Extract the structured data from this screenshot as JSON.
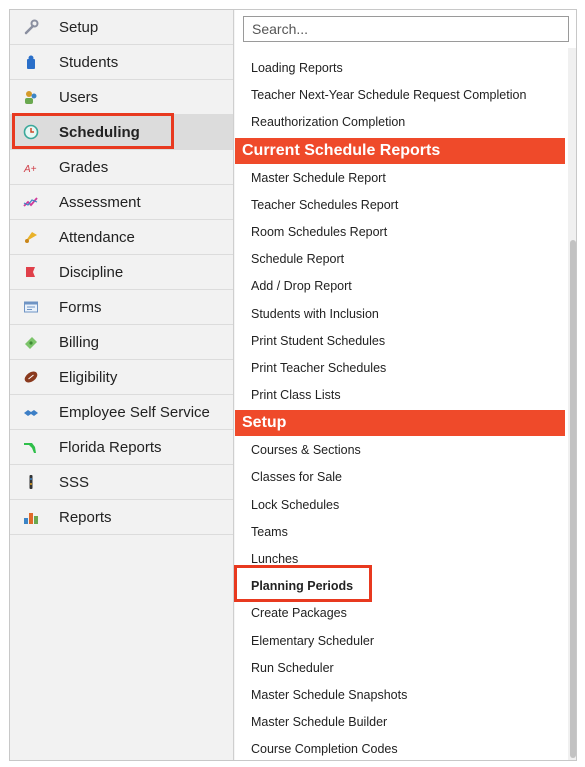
{
  "nav": {
    "items": [
      {
        "label": "Setup",
        "icon": "wrench-icon"
      },
      {
        "label": "Students",
        "icon": "student-icon"
      },
      {
        "label": "Users",
        "icon": "users-icon"
      },
      {
        "label": "Scheduling",
        "icon": "clock-icon"
      },
      {
        "label": "Grades",
        "icon": "grades-icon"
      },
      {
        "label": "Assessment",
        "icon": "assessment-icon"
      },
      {
        "label": "Attendance",
        "icon": "attendance-icon"
      },
      {
        "label": "Discipline",
        "icon": "discipline-icon"
      },
      {
        "label": "Forms",
        "icon": "forms-icon"
      },
      {
        "label": "Billing",
        "icon": "billing-icon"
      },
      {
        "label": "Eligibility",
        "icon": "football-icon"
      },
      {
        "label": "Employee Self Service",
        "icon": "handshake-icon"
      },
      {
        "label": "Florida Reports",
        "icon": "florida-icon"
      },
      {
        "label": "SSS",
        "icon": "sss-icon"
      },
      {
        "label": "Reports",
        "icon": "bar-chart-icon"
      }
    ],
    "active": "Scheduling"
  },
  "search": {
    "placeholder": "Search..."
  },
  "menu": {
    "top_items": [
      "Loading Reports",
      "Teacher Next-Year Schedule Request Completion",
      "Reauthorization Completion"
    ],
    "current_section": "Current Schedule Reports",
    "current_items": [
      "Master Schedule Report",
      "Teacher Schedules Report",
      "Room Schedules Report",
      "Schedule Report",
      "Add / Drop Report",
      "Students with Inclusion",
      "Print Student Schedules",
      "Print Teacher Schedules",
      "Print Class Lists"
    ],
    "setup_section": "Setup",
    "setup_items": [
      "Courses & Sections",
      "Classes for Sale",
      "Lock Schedules",
      "Teams",
      "Lunches",
      "Planning Periods",
      "Create Packages",
      "Elementary Scheduler",
      "Run Scheduler",
      "Master Schedule Snapshots",
      "Master Schedule Builder",
      "Course Completion Codes"
    ]
  },
  "colors": {
    "accent": "#ef4a2a",
    "highlight": "#e8391f"
  }
}
